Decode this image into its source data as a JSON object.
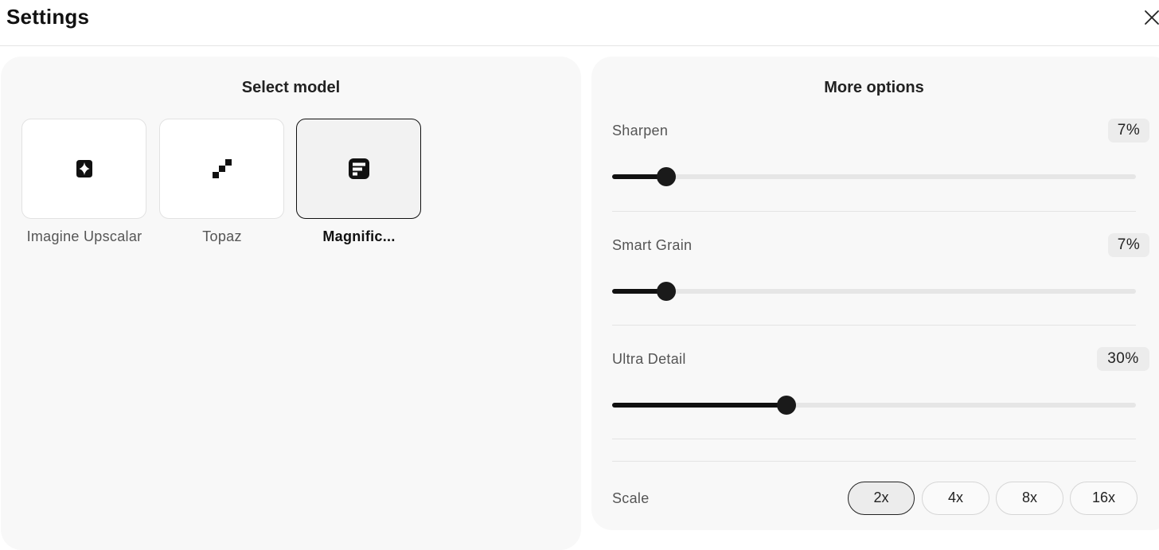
{
  "header": {
    "title": "Settings",
    "close_icon": "close-icon"
  },
  "models": {
    "title": "Select model",
    "items": [
      {
        "label": "Imagine Upscalar",
        "icon": "sparkle-shield-icon",
        "selected": false
      },
      {
        "label": "Topaz",
        "icon": "pixel-stairs-icon",
        "selected": false
      },
      {
        "label": "Magnific...",
        "icon": "document-square-icon",
        "selected": true
      }
    ]
  },
  "options": {
    "title": "More options",
    "sharpen": {
      "label": "Sharpen",
      "value": "7%",
      "level": 0.07
    },
    "smart_grain": {
      "label": "Smart Grain",
      "value": "7%",
      "level": 0.07
    },
    "ultra_detail": {
      "label": "Ultra Detail",
      "value": "30%",
      "level": 0.3
    },
    "scale": {
      "label": "Scale",
      "options": [
        "2x",
        "4x",
        "8x",
        "16x"
      ],
      "selected": "2x"
    }
  },
  "colors": {
    "accent": "#111111",
    "panel": "#f8f8f8",
    "track": "#e6e6e6"
  }
}
